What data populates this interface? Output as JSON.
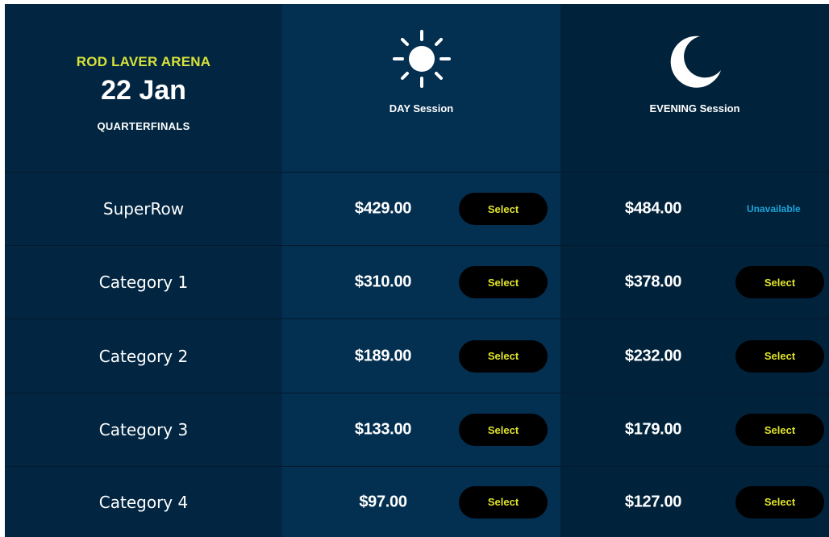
{
  "header": {
    "venue": "ROD LAVER ARENA",
    "date": "22 Jan",
    "round": "QUARTERFINALS",
    "day_session": {
      "label": "DAY Session",
      "icon": "sun-icon"
    },
    "evening_session": {
      "label": "EVENING Session",
      "icon": "moon-icon"
    }
  },
  "colors": {
    "accent": "#d7e23a",
    "button_bg": "#000000",
    "button_text": "#dfe32a",
    "unavailable": "#1ea3d9"
  },
  "rows": [
    {
      "category": "SuperRow",
      "day_price": "$429.00",
      "day_action": "Select",
      "evening_price": "$484.00",
      "evening_action": "Unavailable"
    },
    {
      "category": "Category 1",
      "day_price": "$310.00",
      "day_action": "Select",
      "evening_price": "$378.00",
      "evening_action": "Select"
    },
    {
      "category": "Category 2",
      "day_price": "$189.00",
      "day_action": "Select",
      "evening_price": "$232.00",
      "evening_action": "Select"
    },
    {
      "category": "Category 3",
      "day_price": "$133.00",
      "day_action": "Select",
      "evening_price": "$179.00",
      "evening_action": "Select"
    },
    {
      "category": "Category 4",
      "day_price": "$97.00",
      "day_action": "Select",
      "evening_price": "$127.00",
      "evening_action": "Select"
    }
  ]
}
